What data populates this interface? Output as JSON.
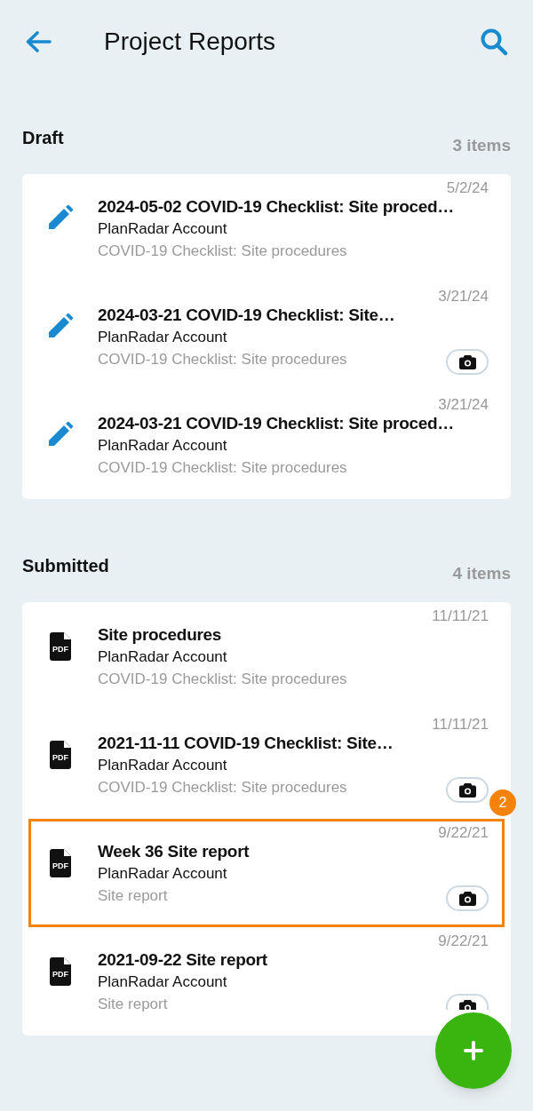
{
  "header": {
    "title": "Project Reports"
  },
  "sections": [
    {
      "title": "Draft",
      "count": "3 items",
      "rows": [
        {
          "kind": "draft",
          "title": "2024-05-02 COVID-19 Checklist: Site proced…",
          "account": "PlanRadar Account",
          "template": "COVID-19 Checklist: Site procedures",
          "date": "5/2/24",
          "has_photos": false,
          "highlighted": false
        },
        {
          "kind": "draft",
          "title": "2024-03-21 COVID-19 Checklist: Site…",
          "account": "PlanRadar Account",
          "template": "COVID-19 Checklist: Site procedures",
          "date": "3/21/24",
          "has_photos": true,
          "highlighted": false
        },
        {
          "kind": "draft",
          "title": "2024-03-21 COVID-19 Checklist: Site proced…",
          "account": "PlanRadar Account",
          "template": "COVID-19 Checklist: Site procedures",
          "date": "3/21/24",
          "has_photos": false,
          "highlighted": false
        }
      ]
    },
    {
      "title": "Submitted",
      "count": "4 items",
      "rows": [
        {
          "kind": "pdf",
          "icon_text": "PDF",
          "title": "Site procedures",
          "account": "PlanRadar Account",
          "template": "COVID-19 Checklist: Site procedures",
          "date": "11/11/21",
          "has_photos": false,
          "highlighted": false
        },
        {
          "kind": "pdf",
          "icon_text": "PDF",
          "title": "2021-11-11 COVID-19 Checklist: Site…",
          "account": "PlanRadar Account",
          "template": "COVID-19 Checklist: Site procedures",
          "date": "11/11/21",
          "has_photos": true,
          "highlighted": false
        },
        {
          "kind": "pdf",
          "icon_text": "PDF",
          "title": "Week 36 Site report",
          "account": "PlanRadar Account",
          "template": "Site report",
          "date": "9/22/21",
          "has_photos": true,
          "highlighted": true,
          "callout": "2"
        },
        {
          "kind": "pdf",
          "icon_text": "PDF",
          "title": "2021-09-22 Site report",
          "account": "PlanRadar Account",
          "template": "Site report",
          "date": "9/22/21",
          "has_photos": true,
          "highlighted": false
        }
      ]
    }
  ]
}
